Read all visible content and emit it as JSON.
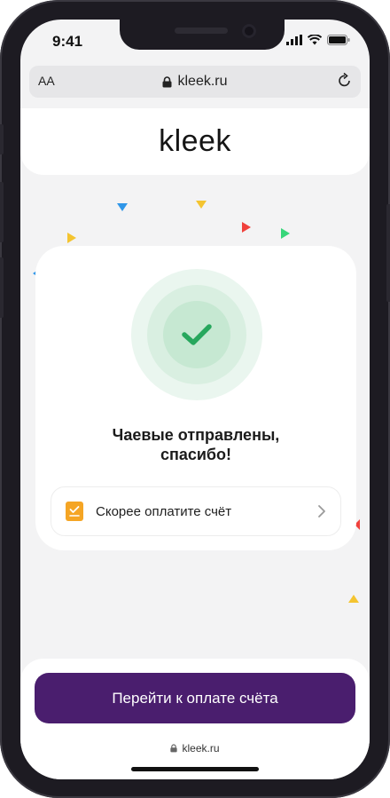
{
  "status_bar": {
    "time": "9:41"
  },
  "browser": {
    "aa_label": "AA",
    "url": "kleek.ru"
  },
  "header": {
    "logo": "kleek"
  },
  "success": {
    "title": "Чаевые отправлены, спасибо!"
  },
  "pay_row": {
    "label": "Скорее оплатите счёт"
  },
  "cta": {
    "label": "Перейти к оплате счёта"
  },
  "footer": {
    "url": "kleek.ru"
  },
  "colors": {
    "accent": "#4a1e6e",
    "success": "#27a75d",
    "receipt_icon": "#f5a524"
  },
  "icons": [
    "lock-icon",
    "reload-icon",
    "check-icon",
    "receipt-icon",
    "chevron-right-icon",
    "signal-icon",
    "wifi-icon",
    "battery-icon"
  ]
}
